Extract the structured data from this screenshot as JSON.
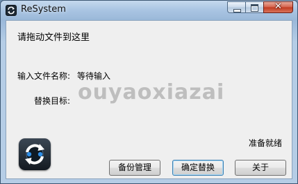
{
  "window": {
    "title": "ReSystem",
    "close_glyph": "✕"
  },
  "main": {
    "prompt": "请拖动文件到这里",
    "input_name_label": "输入文件名称:",
    "input_name_value": "等待输入",
    "target_label": "替换目标:",
    "watermark": "ouyaoxiazai",
    "status": "准备就绪"
  },
  "buttons": {
    "backup": "备份管理",
    "confirm": "确定替换",
    "about": "关于"
  },
  "icons": {
    "app": "refresh-arrows-icon",
    "big": "refresh-arrows-icon"
  },
  "colors": {
    "titlebar": "#a9c4e2",
    "client_bg": "#efefef",
    "close_button": "#c0391f",
    "arrow_blue": "#2f8fe8"
  }
}
